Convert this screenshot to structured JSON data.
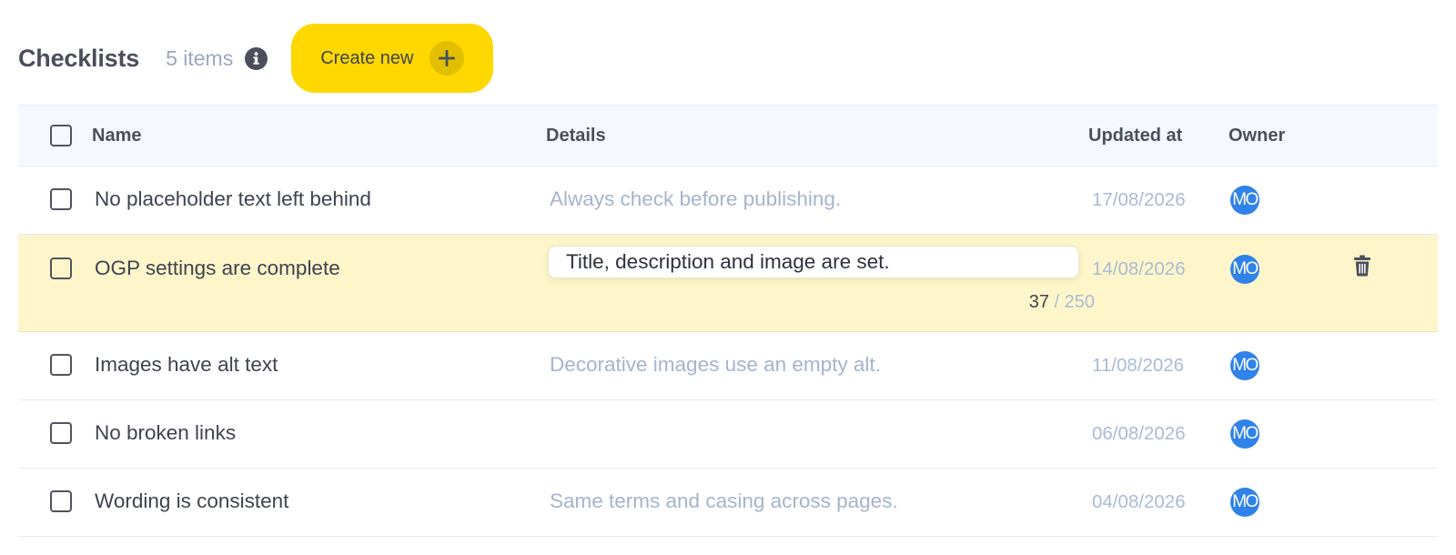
{
  "header": {
    "title": "Checklists",
    "count": "5 items",
    "create_label": "Create new",
    "accent_color": "#ffd800"
  },
  "table": {
    "columns": {
      "name": "Name",
      "details": "Details",
      "updated_at": "Updated at",
      "owner": "Owner"
    },
    "rows": [
      {
        "name": "No placeholder text left behind",
        "details": "Always check before publishing.",
        "updated_at": "17/08/2026",
        "owner_initials": "MO"
      },
      {
        "name": "OGP settings are complete",
        "details": "Title, description and image are set.",
        "updated_at": "14/08/2026",
        "owner_initials": "MO",
        "char_count": "37",
        "char_max": "/ 250"
      },
      {
        "name": "Images have alt text",
        "details": "Decorative images use an empty alt.",
        "updated_at": "11/08/2026",
        "owner_initials": "MO"
      },
      {
        "name": "No broken links",
        "details": "",
        "updated_at": "06/08/2026",
        "owner_initials": "MO"
      },
      {
        "name": "Wording is consistent",
        "details": "Same terms and casing across pages.",
        "updated_at": "04/08/2026",
        "owner_initials": "MO"
      }
    ]
  },
  "icons": {
    "info": "info-icon",
    "plus": "plus-icon",
    "delete": "trash-icon"
  }
}
